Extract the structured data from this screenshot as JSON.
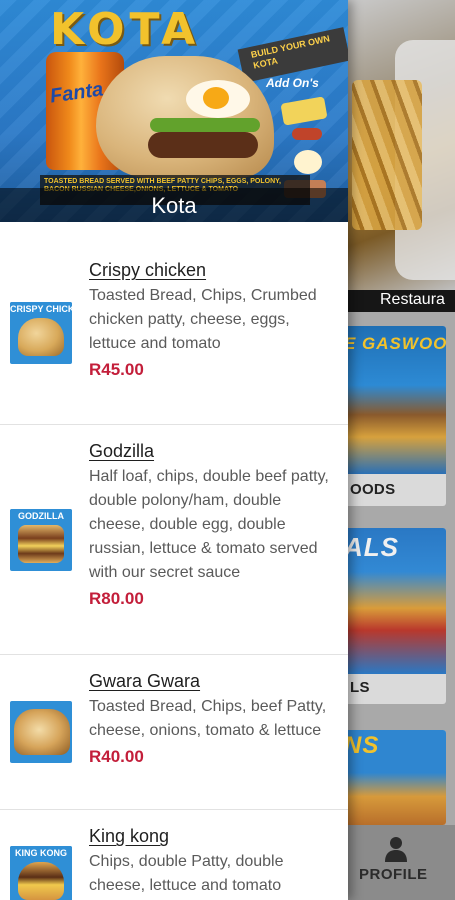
{
  "drawer": {
    "header": {
      "title": "Kota",
      "banner_brand": "KOTA",
      "banner_build": "BUILD YOUR OWN KOTA",
      "banner_addons": "Add On's",
      "banner_can": "Fanta",
      "banner_tagline": "TOASTED BREAD SERVED WITH BEEF PATTY CHIPS, EGGS, POLONY, BACON RUSSIAN CHEESE,ONIONS, LETTUCE & TOMATO"
    },
    "items": [
      {
        "name": "Crispy chicken",
        "description": "Toasted Bread, Chips, Crumbed chicken patty, cheese, eggs, lettuce and tomato",
        "price": "R45.00",
        "thumb_caption": "CRISPY CHICKEN"
      },
      {
        "name": "Godzilla",
        "description": "Half loaf, chips, double beef patty, double polony/ham, double cheese, double egg, double russian, lettuce & tomato served with our secret sauce",
        "price": "R80.00",
        "thumb_caption": "GODZILLA"
      },
      {
        "name": "Gwara Gwara",
        "description": "Toasted Bread, Chips, beef Patty, cheese, onions, tomato & lettuce",
        "price": "R40.00",
        "thumb_caption": ""
      },
      {
        "name": "King kong",
        "description": "Chips, double Patty, double cheese, lettuce and tomato",
        "price": "",
        "thumb_caption": "KING KONG"
      }
    ]
  },
  "background": {
    "tab_label": "Restaura",
    "cards": [
      {
        "title": "E GASWOOD",
        "caption": "OODS"
      },
      {
        "title": "ALS",
        "caption": "LS"
      },
      {
        "title": "NS",
        "caption": ""
      }
    ],
    "bottom_nav": {
      "profile_label": "PROFILE"
    }
  },
  "colors": {
    "price": "#c31e3a",
    "header_blue": "#2b79c7",
    "brand_yellow": "#f2c22c"
  }
}
